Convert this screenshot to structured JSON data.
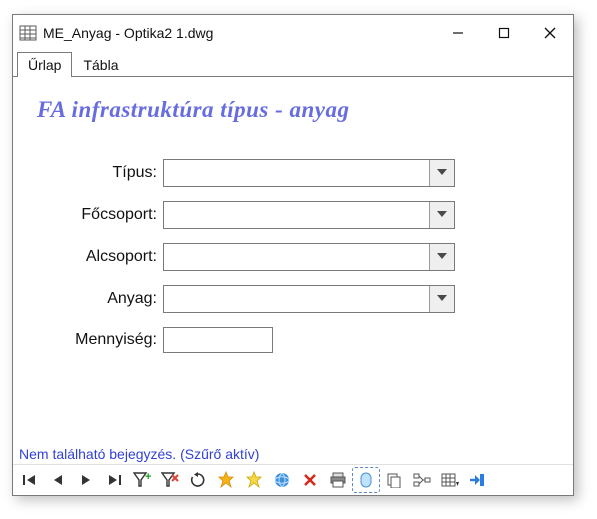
{
  "window": {
    "title": "ME_Anyag - Optika2 1.dwg"
  },
  "tabs": [
    {
      "label": "Űrlap",
      "active": true
    },
    {
      "label": "Tábla",
      "active": false
    }
  ],
  "form": {
    "heading": "FA infrastruktúra típus - anyag",
    "fields": {
      "tipus": {
        "label": "Típus:",
        "value": ""
      },
      "focsoport": {
        "label": "Főcsoport:",
        "value": ""
      },
      "alcsoport": {
        "label": "Alcsoport:",
        "value": ""
      },
      "anyag": {
        "label": "Anyag:",
        "value": ""
      },
      "mennyiseg": {
        "label": "Mennyiség:",
        "value": ""
      }
    }
  },
  "status": {
    "text": "Nem található bejegyzés. (Szűrő aktív)"
  },
  "toolbar_icons": {
    "first": "first-record-icon",
    "prev": "previous-record-icon",
    "next": "next-record-icon",
    "last": "last-record-icon",
    "filter_add": "filter-add-icon",
    "filter_clear": "filter-clear-icon",
    "refresh": "refresh-icon",
    "new": "new-record-icon",
    "highlight": "highlight-icon",
    "globe": "zoom-to-icon",
    "delete": "delete-icon",
    "print": "print-icon",
    "strip": "toggle-strip-icon",
    "copy": "copy-icon",
    "struct": "structure-icon",
    "table": "table-options-icon",
    "exit": "exit-icon"
  }
}
